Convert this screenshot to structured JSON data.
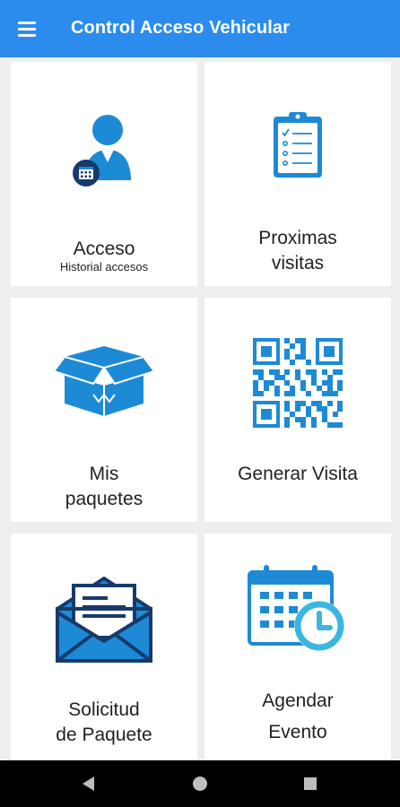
{
  "appbar": {
    "title": "Control Acceso Vehicular",
    "menu_icon": "hamburger-menu-icon"
  },
  "cards": {
    "acceso": {
      "label": "Acceso",
      "sublabel": "Historial accesos",
      "icon": "person-calendar-icon"
    },
    "proximas": {
      "line1": "Proximas",
      "line2": "visitas",
      "icon": "clipboard-checklist-icon"
    },
    "paquetes": {
      "line1": "Mis",
      "line2": "paquetes",
      "icon": "open-box-icon"
    },
    "generar": {
      "label": "Generar Visita",
      "icon": "qr-code-icon"
    },
    "solicitud": {
      "line1": "Solicitud",
      "line2": "de Paquete",
      "icon": "envelope-letter-icon"
    },
    "agendar": {
      "line1": "Agendar",
      "line2": "Evento",
      "icon": "calendar-clock-icon"
    }
  },
  "navbar": {
    "back_icon": "back-triangle-icon",
    "home_icon": "home-circle-icon",
    "recents_icon": "recents-square-icon"
  },
  "colors": {
    "appbar": "#2b8cee",
    "icon_blue": "#1d8ad6",
    "icon_dark": "#173a6b",
    "background": "#eeeeee"
  }
}
